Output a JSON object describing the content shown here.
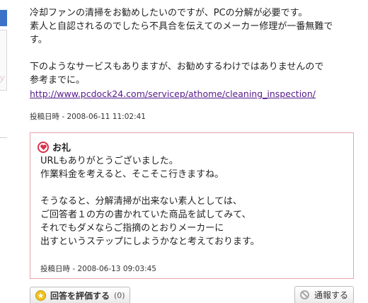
{
  "answer": {
    "lines_a": [
      "冷却ファンの清掃をお勧めしたいのですが、PCの分解が必要です。",
      "素人と自認されるのでしたら不具合を伝えてのメーカー修理が一番無難で",
      "す。"
    ],
    "lines_b": [
      "下のようなサービスもありますが、お勧めするわけではありませんので",
      "参考までに。"
    ],
    "link": "http://www.pcdock24.com/servicep/athome/cleaning_inspection/",
    "posted": "投稿日時 - 2008-06-11 11:02:41"
  },
  "gutter": {
    "partial_text": "y"
  },
  "thanks": {
    "title": "お礼",
    "lines_a": [
      "URLもありがとうございました。",
      "作業料金を考えると、そこそこ行きますね。"
    ],
    "lines_b": [
      "そうなると、分解清掃が出来ない素人としては、",
      "ご回答者１の方の書かれていた商品を試してみて、",
      "それでもダメならご指摘のとおりメーカーに",
      "出すというステップにしようかなと考えております。"
    ],
    "posted": "投稿日時 - 2008-06-13 09:03:45"
  },
  "actions": {
    "rate_label": "回答を評価する",
    "rate_count": "(0)",
    "report_label": "通報する"
  },
  "colors": {
    "link": "#551a8b",
    "thanks_border": "#e7a2ad",
    "heart": "#d8324a",
    "star": "#f1c21b",
    "sidebar_accent": "#3a72c8"
  }
}
